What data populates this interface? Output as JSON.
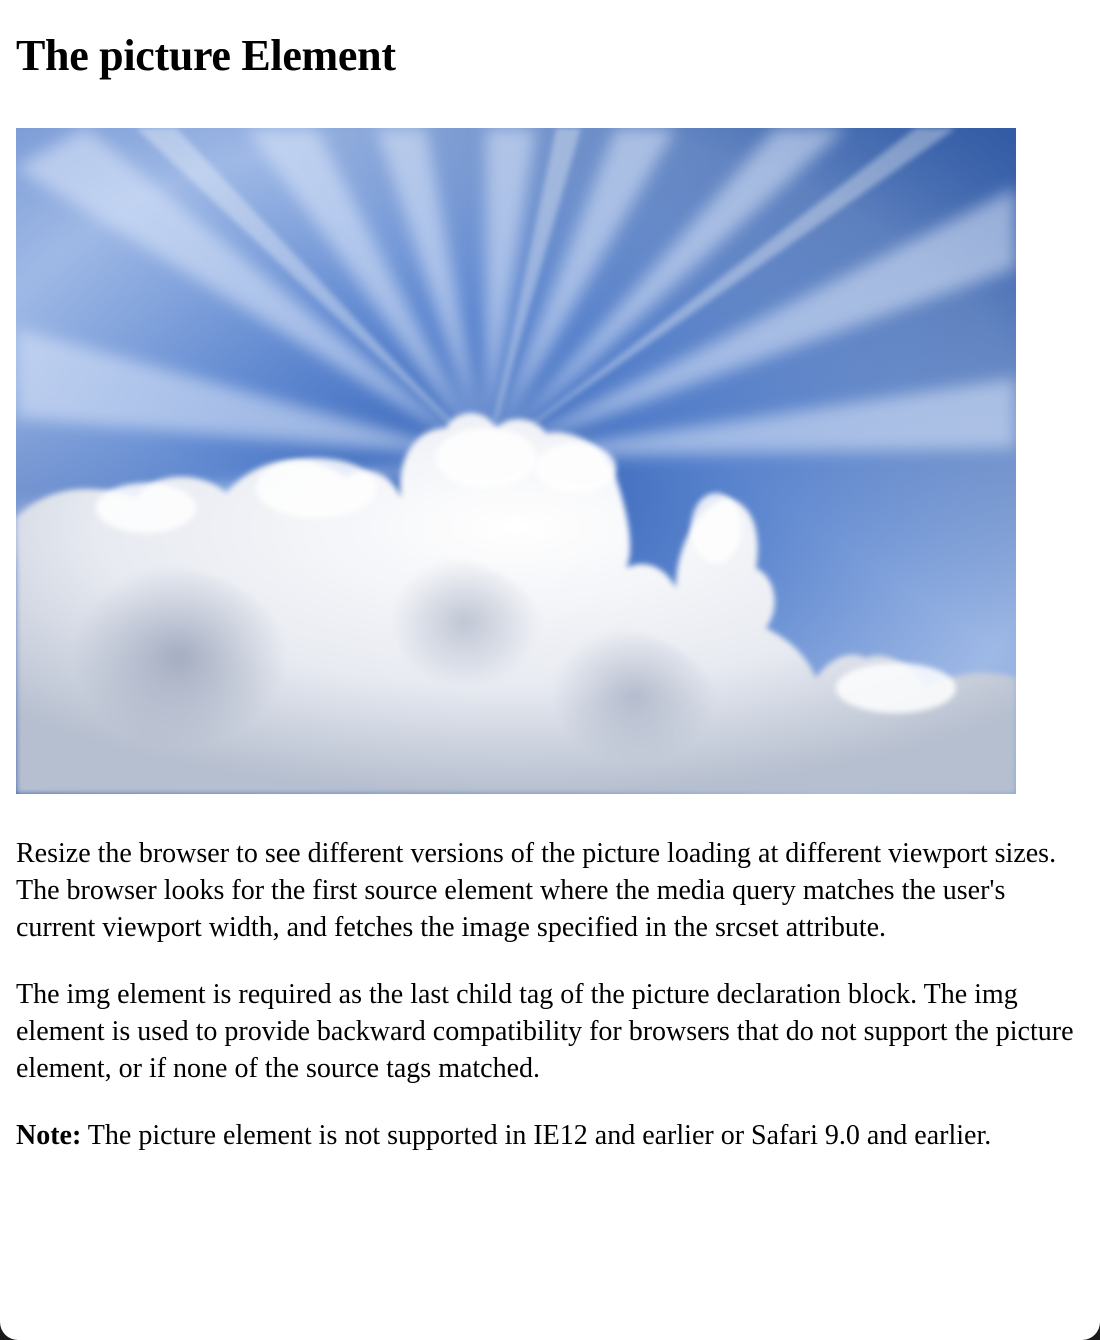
{
  "heading": "The picture Element",
  "paragraphs": [
    "Resize the browser to see different versions of the picture loading at different viewport sizes. The browser looks for the first source element where the media query matches the user's current viewport width, and fetches the image specified in the srcset attribute.",
    "The img element is required as the last child tag of the picture declaration block. The img element is used to provide backward compatibility for browsers that do not support the picture element, or if none of the source tags matched."
  ],
  "note": {
    "label": "Note:",
    "text": " The picture element is not supported in IE12 and earlier or Safari 9.0 and earlier."
  },
  "colors": {
    "sky_light": "#a9c3ec",
    "sky_deep": "#3e68b8",
    "cloud": "#f4f6fa"
  }
}
